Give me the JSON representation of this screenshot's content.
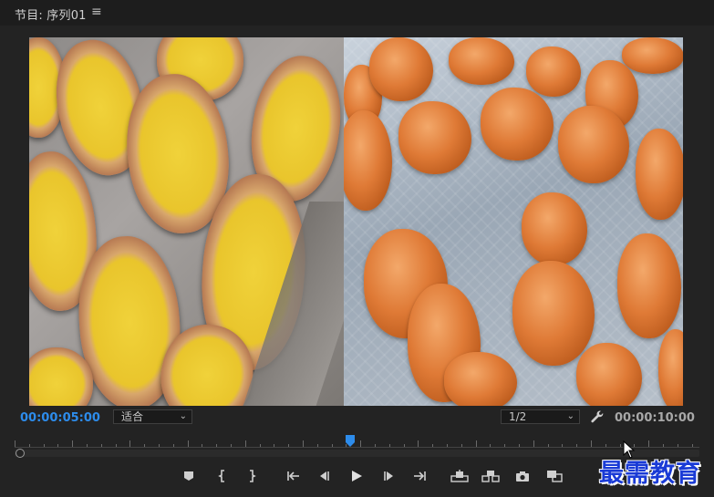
{
  "panel": {
    "title": "节目: 序列01",
    "menu_icon": "hamburger-menu-icon"
  },
  "monitor": {
    "current_timecode": "00:00:05:00",
    "duration_timecode": "00:00:10:00",
    "fit_dropdown": {
      "selected": "适合"
    },
    "resolution_dropdown": {
      "selected": "1/2"
    }
  },
  "timeline": {
    "playhead_position_fraction": 0.49
  },
  "transport_buttons": [
    {
      "name": "add-marker-button",
      "icon": "marker-icon"
    },
    {
      "name": "mark-in-button",
      "icon": "mark-in-icon"
    },
    {
      "name": "mark-out-button",
      "icon": "mark-out-icon"
    },
    {
      "name": "go-to-in-button",
      "icon": "go-to-in-icon"
    },
    {
      "name": "step-back-button",
      "icon": "step-back-icon"
    },
    {
      "name": "play-button",
      "icon": "play-icon"
    },
    {
      "name": "step-forward-button",
      "icon": "step-forward-icon"
    },
    {
      "name": "go-to-out-button",
      "icon": "go-to-out-icon"
    },
    {
      "name": "lift-button",
      "icon": "lift-icon"
    },
    {
      "name": "extract-button",
      "icon": "extract-icon"
    },
    {
      "name": "export-frame-button",
      "icon": "camera-icon"
    },
    {
      "name": "comparison-view-button",
      "icon": "comparison-view-icon"
    }
  ],
  "watermark": "最需教育",
  "colors": {
    "timecode_active": "#2d8ceb",
    "timecode_inactive": "#a8a8a8",
    "playhead": "#2d8ceb",
    "panel_bg": "#232323"
  }
}
